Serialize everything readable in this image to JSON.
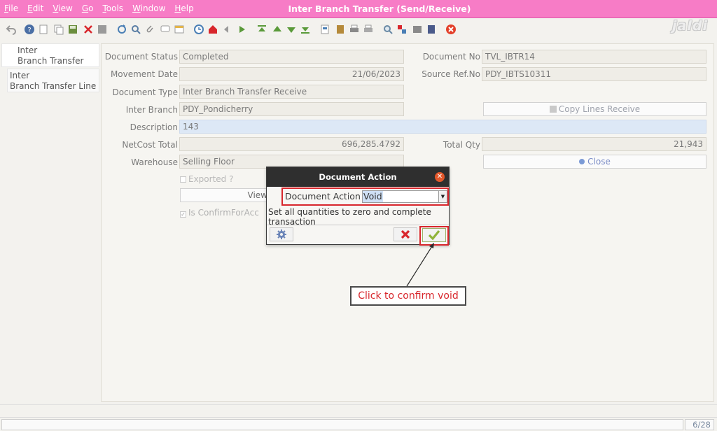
{
  "menu": [
    "File",
    "Edit",
    "View",
    "Go",
    "Tools",
    "Window",
    "Help"
  ],
  "window_title": "Inter Branch Transfer (Send/Receive)",
  "logo": "jaldi",
  "toolbar_icons": [
    "undo-icon",
    "help-icon",
    "new-record-icon",
    "copy-record-icon",
    "save-icon",
    "delete-icon",
    "grid-toggle-icon",
    "refresh-icon",
    "find-icon",
    "attachment-icon",
    "chat-icon",
    "multi-record-icon",
    "history-icon",
    "home-icon",
    "previous-icon",
    "next-icon",
    "first-record-icon",
    "parent-record-icon",
    "detail-record-icon",
    "last-record-icon",
    "report-icon",
    "archive-icon",
    "print-icon",
    "print-preview-icon",
    "zoom-across-icon",
    "request-icon",
    "product-info-icon",
    "workflow-icon",
    "close-window-icon"
  ],
  "left_tabs": [
    {
      "line1": "Inter",
      "line2": "Branch Transfer"
    },
    {
      "line1": "Inter",
      "line2": "Branch Transfer Line"
    }
  ],
  "form": {
    "document_status": {
      "label": "Document Status",
      "value": "Completed"
    },
    "document_no": {
      "label": "Document No",
      "value": "TVL_IBTR14"
    },
    "movement_date": {
      "label": "Movement Date",
      "value": "21/06/2023"
    },
    "source_ref_no": {
      "label": "Source Ref.No",
      "value": "PDY_IBTS10311"
    },
    "document_type": {
      "label": "Document Type",
      "value": "Inter Branch Transfer Receive"
    },
    "inter_branch": {
      "label": "Inter Branch",
      "value": "PDY_Pondicherry"
    },
    "copy_lines_receive": "Copy Lines Receive",
    "description": {
      "label": "Description",
      "value": "143"
    },
    "netcost_total": {
      "label": "NetCost Total",
      "value": "696,285.4792"
    },
    "total_qty": {
      "label": "Total Qty",
      "value": "21,943"
    },
    "warehouse": {
      "label": "Warehouse",
      "value": "Selling Floor"
    },
    "close_button": "Close",
    "exported": "Exported ?",
    "view_button": "View",
    "is_confirm": "Is ConfirmForAcc"
  },
  "dialog": {
    "title": "Document Action",
    "action_label": "Document Action",
    "action_value": "Void",
    "description": "Set all quantities to zero and complete transaction"
  },
  "callout": "Click to confirm void",
  "status": {
    "page": "6/28"
  },
  "colors": {
    "title_bar": "#f77cc6",
    "highlight": "#d8262c",
    "description_field": "#dde8f6"
  }
}
